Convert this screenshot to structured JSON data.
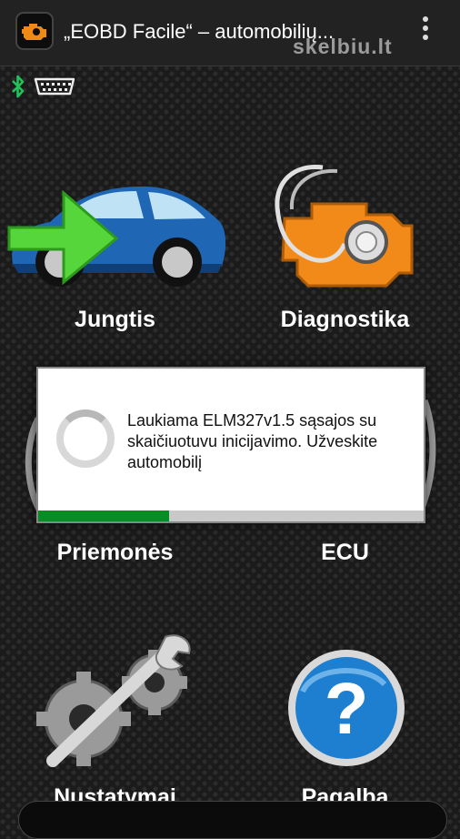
{
  "header": {
    "title": "„EOBD Facile“ – automobilių...",
    "watermark": "skelbiu.lt",
    "app_icon": "engine-check-icon",
    "menu_icon": "overflow-menu-icon"
  },
  "status": {
    "bluetooth_icon": "bluetooth-icon",
    "obd_icon": "obd-adapter-icon",
    "bluetooth_color": "#22c35a"
  },
  "tiles": [
    {
      "label": "Jungtis",
      "icon": "car-connect-icon"
    },
    {
      "label": "Diagnostika",
      "icon": "engine-stethoscope-icon"
    },
    {
      "label": "Priemonės",
      "icon": "tools-icon"
    },
    {
      "label": "ECU",
      "icon": "ecu-icon"
    },
    {
      "label": "Nustatymai",
      "icon": "settings-gears-icon"
    },
    {
      "label": "Pagalba",
      "icon": "help-icon"
    }
  ],
  "dialog": {
    "message": "Laukiama ELM327v1.5 sąsajos su skaičiuotuvu inicijavimo. Užveskite automobilį",
    "progress": 0.34,
    "progress_color": "#0a8c24"
  }
}
